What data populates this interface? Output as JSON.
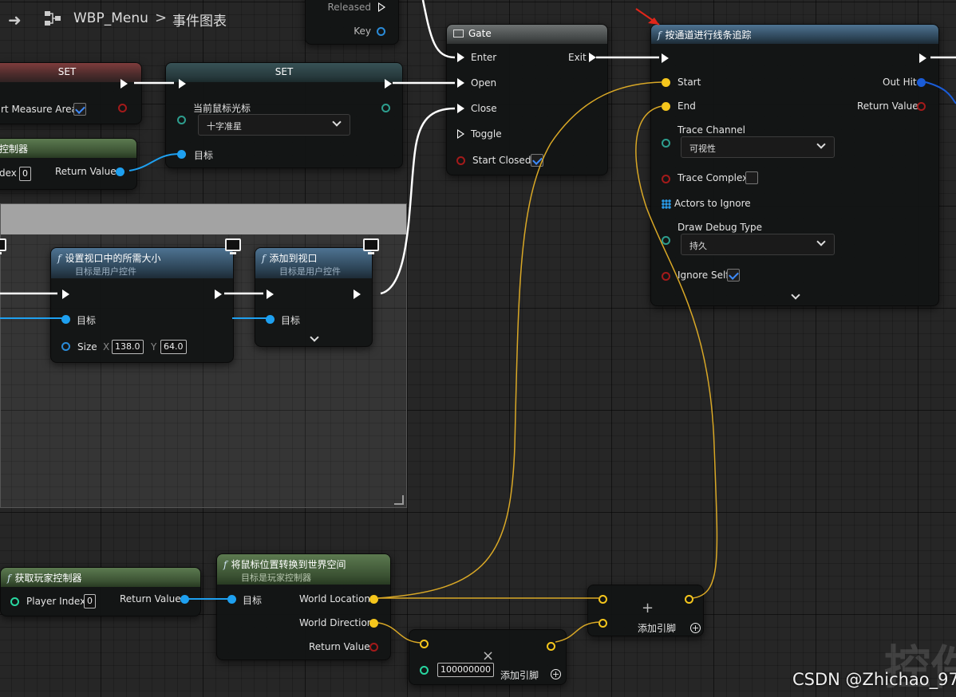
{
  "breadcrumb": {
    "blueprint": "WBP_Menu",
    "separator": ">",
    "graph": "事件图表"
  },
  "colors": {
    "exec": "#ffffff",
    "object": "#1ea0f0",
    "vector": "#f5c61c",
    "bool": "#a31a1a",
    "struct": "#2d9e8e",
    "int": "#28d7a0",
    "wire_vector": "#d9a826"
  },
  "nodes": {
    "input_partial": {
      "released": "Released",
      "key": "Key"
    },
    "set1": {
      "title": "SET",
      "var": "rt Measure Area"
    },
    "set2": {
      "title": "SET",
      "var": "当前鼠标光标",
      "value": "十字准星",
      "target": "目标"
    },
    "getpc_top": {
      "title": "控制器",
      "index_label": "dex",
      "index_value": "0",
      "return": "Return Value"
    },
    "gate": {
      "title": "Gate",
      "enter": "Enter",
      "open": "Open",
      "close": "Close",
      "toggle": "Toggle",
      "start_closed": "Start Closed",
      "exit": "Exit"
    },
    "linetrace": {
      "title": "按通道进行线条追踪",
      "start": "Start",
      "end": "End",
      "trace_channel": "Trace Channel",
      "trace_channel_value": "可视性",
      "trace_complex": "Trace Complex",
      "actors_ignore": "Actors to Ignore",
      "draw_debug": "Draw Debug Type",
      "draw_debug_value": "持久",
      "ignore_self": "Ignore Self",
      "out_hit": "Out Hit",
      "return": "Return Value"
    },
    "setsize": {
      "title": "设置视口中的所需大小",
      "subtitle": "目标是用户控件",
      "target": "目标",
      "size": "Size",
      "x_label": "X",
      "x": "138.0",
      "y_label": "Y",
      "y": "64.0"
    },
    "addviewport": {
      "title": "添加到视口",
      "subtitle": "目标是用户控件",
      "target": "目标"
    },
    "getpc": {
      "title": "获取玩家控制器",
      "index_label": "Player Index",
      "index_value": "0",
      "return": "Return Value"
    },
    "deproject": {
      "title": "将鼠标位置转换到世界空间",
      "subtitle": "目标是玩家控制器",
      "target": "目标",
      "world_location": "World Location",
      "world_direction": "World Direction",
      "return": "Return Value"
    },
    "add": {
      "symbol": "+",
      "label": "添加引脚"
    },
    "multiply": {
      "symbol": "×",
      "value": "100000000",
      "label": "添加引脚"
    }
  },
  "watermark": "CSDN @Zhichao_97",
  "watermark_faint": "控件"
}
